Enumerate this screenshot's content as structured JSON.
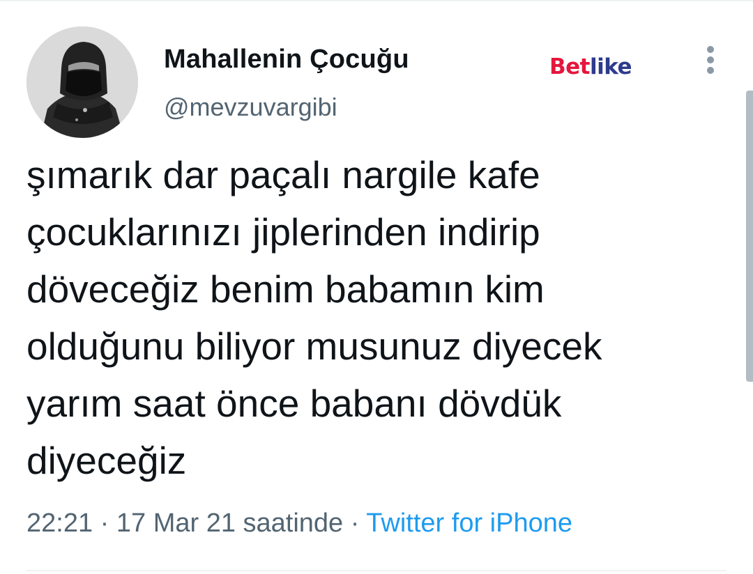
{
  "tweet": {
    "author_name": "Mahallenin Çocuğu",
    "author_handle": "@mevzuvargibi",
    "text": "şımarık dar paçalı nargile kafe\nçocuklarınızı jiplerinden indirip\ndöveceğiz benim babamın kim\nolduğunu biliyor musunuz diyecek\nyarım saat önce babanı dövdük\ndiyeceğiz",
    "time": "22:21",
    "separator": " · ",
    "date": "17 Mar 21 saatinde",
    "source": "Twitter for iPhone"
  },
  "watermark": {
    "part_a": "Bet",
    "part_b": "like",
    "color_a": "#e5163d",
    "color_b": "#2d3b8c"
  },
  "icons": {
    "more": "more-vertical-icon",
    "avatar": "profile-avatar-image"
  },
  "colors": {
    "text": "#0f1419",
    "secondary": "#536471",
    "link": "#1d9bf0"
  }
}
